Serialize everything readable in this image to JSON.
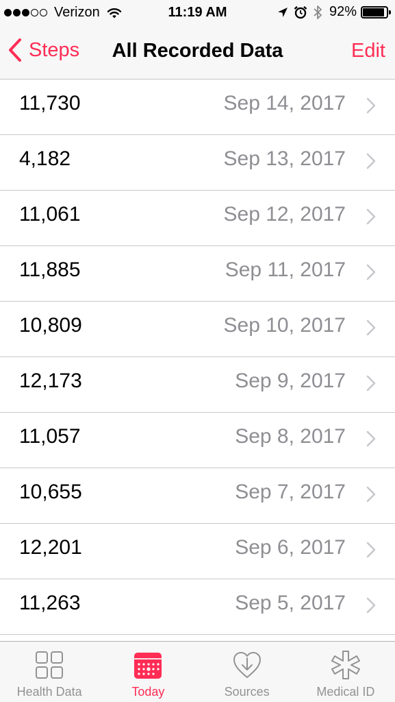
{
  "status_bar": {
    "carrier": "Verizon",
    "time": "11:19 AM",
    "battery_percent": "92%",
    "battery_level": 0.92,
    "signal_bars_filled": 3,
    "signal_bars_total": 5,
    "icons": [
      "wifi-icon",
      "location-arrow-icon",
      "alarm-icon",
      "bluetooth-icon",
      "battery-icon"
    ]
  },
  "nav": {
    "back_label": "Steps",
    "title": "All Recorded Data",
    "edit_label": "Edit"
  },
  "records": [
    {
      "value": "11,730",
      "date": "Sep 14, 2017"
    },
    {
      "value": "4,182",
      "date": "Sep 13, 2017"
    },
    {
      "value": "11,061",
      "date": "Sep 12, 2017"
    },
    {
      "value": "11,885",
      "date": "Sep 11, 2017"
    },
    {
      "value": "10,809",
      "date": "Sep 10, 2017"
    },
    {
      "value": "12,173",
      "date": "Sep 9, 2017"
    },
    {
      "value": "11,057",
      "date": "Sep 8, 2017"
    },
    {
      "value": "10,655",
      "date": "Sep 7, 2017"
    },
    {
      "value": "12,201",
      "date": "Sep 6, 2017"
    },
    {
      "value": "11,263",
      "date": "Sep 5, 2017"
    }
  ],
  "tabs": [
    {
      "label": "Health Data",
      "icon": "health-data-grid-icon",
      "active": false
    },
    {
      "label": "Today",
      "icon": "today-calendar-icon",
      "active": true
    },
    {
      "label": "Sources",
      "icon": "sources-heart-download-icon",
      "active": false
    },
    {
      "label": "Medical ID",
      "icon": "medical-id-asterisk-icon",
      "active": false
    }
  ],
  "colors": {
    "accent": "#ff2d55",
    "secondary_text": "#8e8e93",
    "tab_inactive": "#929292",
    "bar_background": "#f7f7f7",
    "separator": "#c8c7cc"
  }
}
